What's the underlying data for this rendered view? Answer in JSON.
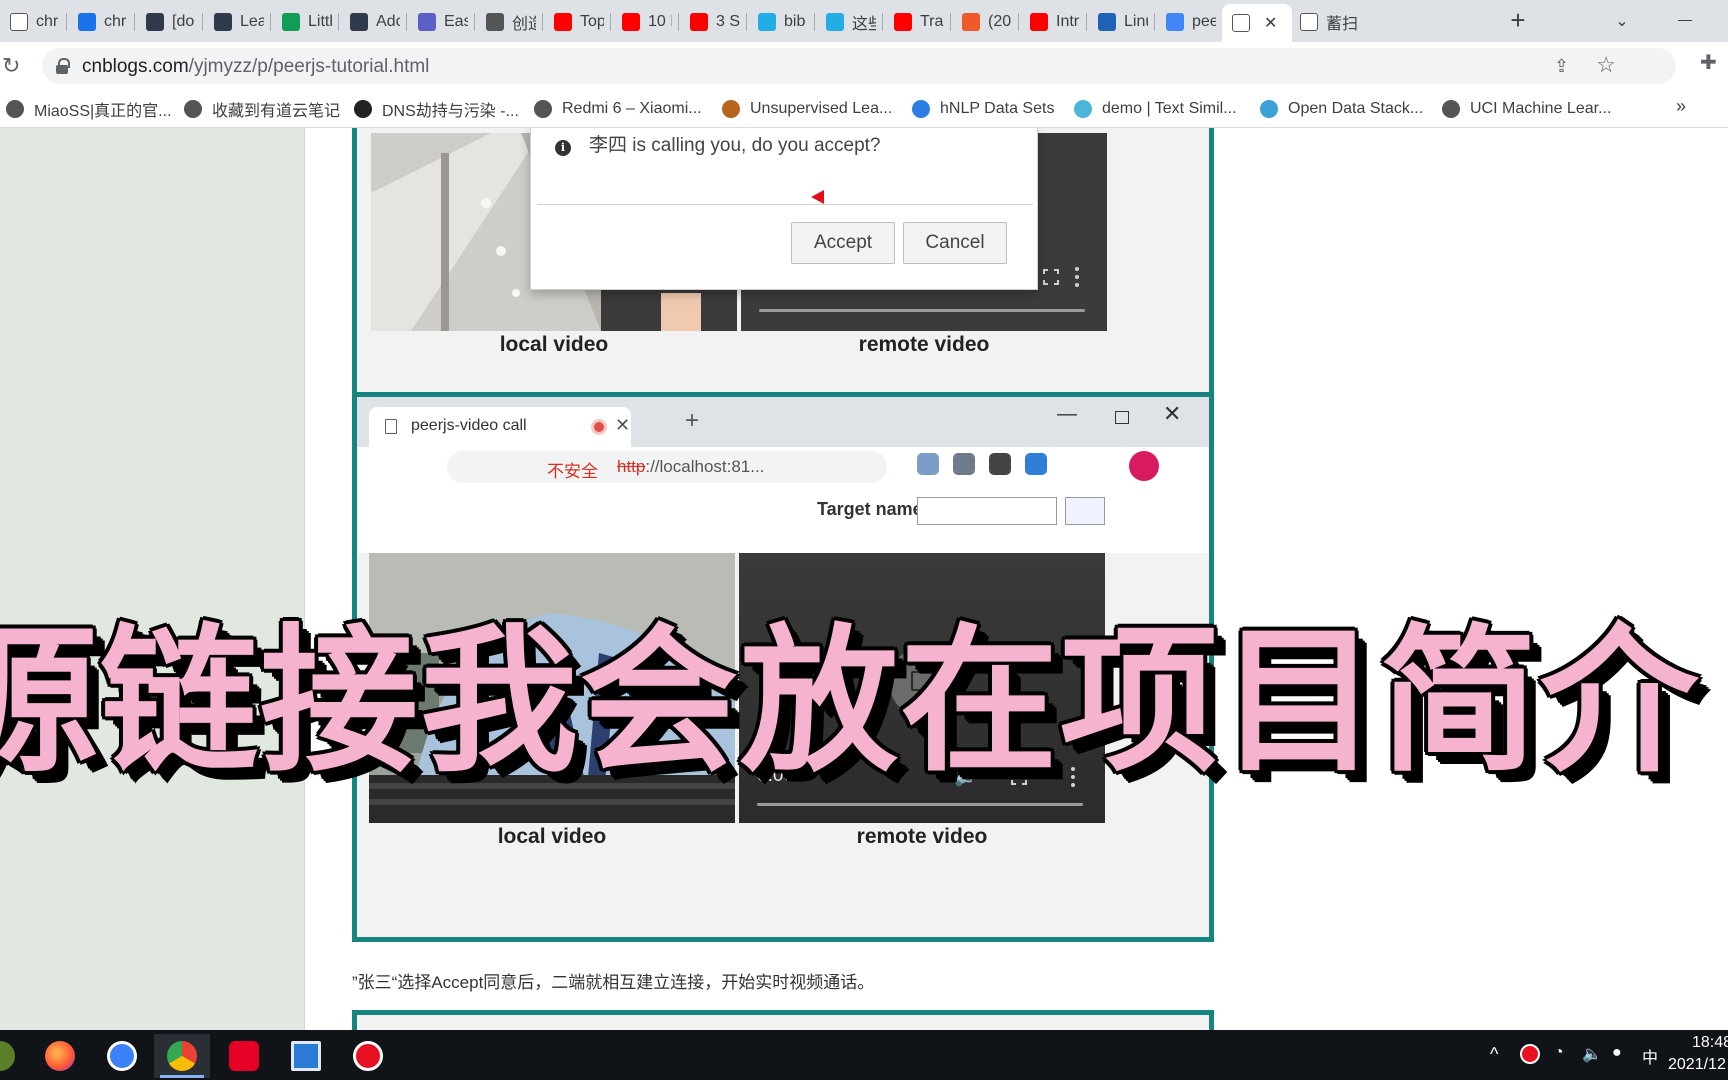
{
  "browser": {
    "tabs": [
      {
        "label": "chr",
        "icon": "cnblogs-icon",
        "color": "#ffffff"
      },
      {
        "label": "chr",
        "icon": "shield-icon",
        "color": "#1a73e8"
      },
      {
        "label": "[do",
        "icon": "lfe-icon",
        "color": "#2f3b4c"
      },
      {
        "label": "Lea",
        "icon": "lfe-icon",
        "color": "#2f3b4c"
      },
      {
        "label": "Littl",
        "icon": "sheets-icon",
        "color": "#0f9d58"
      },
      {
        "label": "Adc",
        "icon": "lfe-icon",
        "color": "#2f3b4c"
      },
      {
        "label": "Eas",
        "icon": "e-icon",
        "color": "#5b5fc7"
      },
      {
        "label": "创造",
        "icon": "figure-icon",
        "color": "#555555"
      },
      {
        "label": "Top",
        "icon": "youtube-icon",
        "color": "#ff0000"
      },
      {
        "label": "10 I",
        "icon": "youtube-icon",
        "color": "#ff0000"
      },
      {
        "label": "3 St",
        "icon": "youtube-icon",
        "color": "#ff0000"
      },
      {
        "label": "bib",
        "icon": "bilibili-icon",
        "color": "#23ade5"
      },
      {
        "label": "这些",
        "icon": "bilibili-icon",
        "color": "#23ade5"
      },
      {
        "label": "Trai",
        "icon": "youtube-icon",
        "color": "#ff0000"
      },
      {
        "label": "(20",
        "icon": "c-icon",
        "color": "#f05a28"
      },
      {
        "label": "Intr",
        "icon": "youtube-icon",
        "color": "#ff0000"
      },
      {
        "label": "Linu",
        "icon": "book-icon",
        "color": "#1e63b5"
      },
      {
        "label": "pee",
        "icon": "google-icon",
        "color": "#4285f4"
      },
      {
        "label": "",
        "icon": "cnblogs-icon",
        "color": "#ffffff"
      },
      {
        "label": "蓄扫",
        "icon": "cnblogs-icon",
        "color": "#ffffff"
      }
    ],
    "url_host": "cnblogs.com",
    "url_path": "/yjmyzz/p/peerjs-tutorial.html",
    "bookmarks": [
      "MiaoSS|真正的官...",
      "收藏到有道云笔记",
      "DNS劫持与污染 -...",
      "Redmi 6 – Xiaomi...",
      "Unsupervised Lea...",
      "hNLP Data Sets",
      "demo | Text Simil...",
      "Open Data Stack...",
      "UCI Machine Lear..."
    ],
    "bookmarks_more": "»"
  },
  "figure1": {
    "dialog_info": "i",
    "dialog_message": "李四 is calling you, do you accept?",
    "accept_label": "Accept",
    "cancel_label": "Cancel",
    "local_label": "local video",
    "remote_label": "remote video"
  },
  "figure2": {
    "tab_title": "peerjs-video call",
    "insecure_label": "不安全",
    "url_scheme": "http",
    "url_rest": "://localhost:81...",
    "form_label": "Target name:",
    "time": "0:00",
    "local_label": "local video",
    "remote_label": "remote video"
  },
  "caption": "”张三“选择Accept同意后，二端就相互建立连接，开始实时视频通话。",
  "overlay_title": "源链接我会放在项目简介",
  "taskbar": {
    "tray_caret": "^",
    "ime": "中",
    "time": "18:48",
    "date": "2021/12"
  }
}
